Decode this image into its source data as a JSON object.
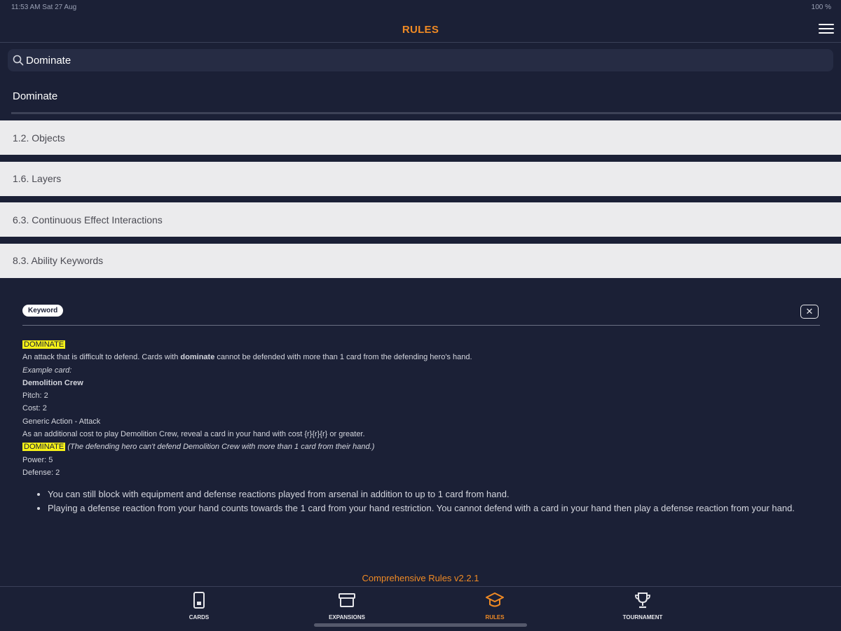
{
  "status_bar": {
    "time": "11:53 AM   Sat 27 Aug",
    "battery": "100 %"
  },
  "header": {
    "title": "RULES"
  },
  "search": {
    "value": "Dominate",
    "placeholder": "Search"
  },
  "search_term": "Dominate",
  "rule_sections": [
    "1.2. Objects",
    "1.6. Layers",
    "6.3. Continuous Effect Interactions",
    "8.3. Ability Keywords"
  ],
  "detail": {
    "badge": "Keyword",
    "keyword": "DOMINATE",
    "desc_before": "An attack that is difficult to defend. Cards with ",
    "desc_bold": "dominate",
    "desc_after": " cannot be defended with more than 1 card from the defending hero's hand.",
    "example_label": "Example card:",
    "card_name": "Demolition Crew",
    "pitch": "Pitch: 2",
    "cost": "Cost: 2",
    "type": "Generic Action - Attack",
    "card_text": "As an additional cost to play Demolition Crew, reveal a card in your hand with cost {r}{r}{r} or greater.",
    "reminder": "(The defending hero can't defend Demolition Crew with more than 1 card from their hand.)",
    "power": "Power: 5",
    "defense": "Defense: 2",
    "bullets": [
      "You can still block with equipment and defense reactions played from arsenal in addition to up to 1 card from hand.",
      "Playing a defense reaction from your hand counts towards the 1 card from your hand restriction. You cannot defend with a card in your hand then play a defense reaction from your hand."
    ]
  },
  "footer": {
    "version": "Comprehensive Rules v2.2.1"
  },
  "tabs": [
    {
      "label": "CARDS",
      "icon": "card-icon"
    },
    {
      "label": "EXPANSIONS",
      "icon": "box-icon"
    },
    {
      "label": "RULES",
      "icon": "graduation-cap-icon"
    },
    {
      "label": "TOURNAMENT",
      "icon": "trophy-icon"
    }
  ],
  "colors": {
    "background": "#1b2036",
    "accent": "#f08a24",
    "highlight": "#f5f017",
    "row": "#ebebed"
  }
}
